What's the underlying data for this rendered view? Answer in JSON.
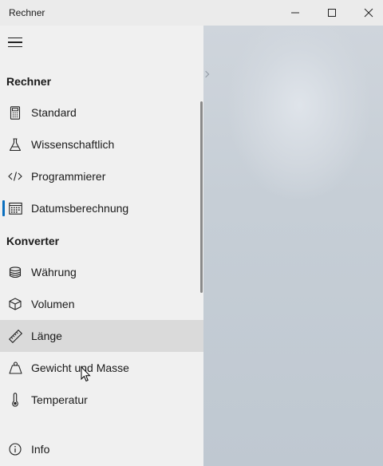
{
  "window": {
    "title": "Rechner"
  },
  "nav": {
    "sections": [
      {
        "heading": "Rechner",
        "items": [
          {
            "label": "Standard",
            "icon": "calculator-icon"
          },
          {
            "label": "Wissenschaftlich",
            "icon": "flask-icon"
          },
          {
            "label": "Programmierer",
            "icon": "code-icon"
          },
          {
            "label": "Datumsberechnung",
            "icon": "calendar-icon",
            "selected": true
          }
        ]
      },
      {
        "heading": "Konverter",
        "items": [
          {
            "label": "Währung",
            "icon": "coins-icon"
          },
          {
            "label": "Volumen",
            "icon": "cube-icon"
          },
          {
            "label": "Länge",
            "icon": "ruler-icon",
            "hovered": true
          },
          {
            "label": "Gewicht und Masse",
            "icon": "weight-icon"
          },
          {
            "label": "Temperatur",
            "icon": "thermometer-icon"
          }
        ]
      }
    ],
    "footer": {
      "label": "Info",
      "icon": "info-icon"
    }
  },
  "colors": {
    "accent": "#0a6fbf",
    "nav_background": "#f0f0f0",
    "hover_background": "#dadada"
  }
}
